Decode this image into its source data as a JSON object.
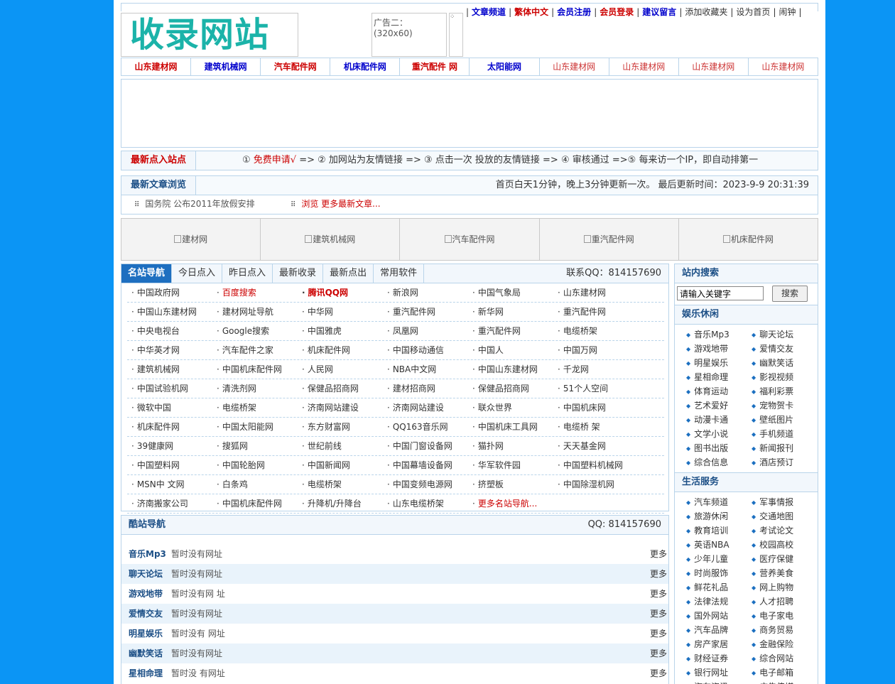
{
  "logo": {
    "text": "收录网站"
  },
  "ads": {
    "ad2": "广告二：(320x60)"
  },
  "top_links": [
    {
      "label": "文章频道",
      "color": "#0000cc"
    },
    {
      "label": "繁体中文",
      "color": "#cc0000"
    },
    {
      "label": "会员注册",
      "color": "#0000cc"
    },
    {
      "label": "会员登录",
      "color": "#cc0000"
    },
    {
      "label": "建议留言",
      "color": "#0000cc"
    },
    {
      "label": "添加收藏夹",
      "color": "#333333"
    },
    {
      "label": "设为首页",
      "color": "#333333"
    },
    {
      "label": "闹钟",
      "color": "#333333"
    }
  ],
  "nav_links": [
    {
      "label": "山东建材网",
      "color": "#cc0000"
    },
    {
      "label": "建筑机械网",
      "color": "#0000cc"
    },
    {
      "label": "汽车配件网",
      "color": "#cc0000"
    },
    {
      "label": "机床配件网",
      "color": "#0000cc"
    },
    {
      "label": "重汽配件 网",
      "color": "#cc0000"
    },
    {
      "label": "太阳能网",
      "color": "#0000cc"
    },
    {
      "label": "山东建材网",
      "color": "#cc3333"
    },
    {
      "label": "山东建材网",
      "color": "#cc3333"
    },
    {
      "label": "山东建材网",
      "color": "#cc3333"
    },
    {
      "label": "山东建材网",
      "color": "#cc3333"
    }
  ],
  "newest_join": {
    "label": "最新点入站点",
    "steps_prefix": "① ",
    "apply": "免费申请√",
    "steps_rest": " => ② 加网站为友情链接 => ③ 点击一次 投放的友情链接 => ④ 审核通过 =>⑤ 每来访一个IP，即自动排第一"
  },
  "newest_articles": {
    "label": "最新文章浏览",
    "update_info": "首页白天1分钟，晚上3分钟更新一次。 最后更新时间：2023-9-9 20:31:39",
    "items": [
      {
        "label": "国务院 公布2011年放假安排",
        "color": "#555555"
      },
      {
        "label": "浏览 更多最新文章...",
        "color": "#cc0000"
      }
    ]
  },
  "image_links": [
    "建材网",
    "建筑机械网",
    "汽车配件网",
    "重汽配件网",
    "机床配件网"
  ],
  "famous_sites": {
    "tabs": [
      "名站导航",
      "今日点入",
      "昨日点入",
      "最新收录",
      "最新点出",
      "常用软件"
    ],
    "qq": "联系QQ：814157690",
    "rows": [
      [
        {
          "t": "中国政府网"
        },
        {
          "t": "百度搜索",
          "c": "#cc0000"
        },
        {
          "t": "腾讯QQ网",
          "c": "#cc0000",
          "b": true
        },
        {
          "t": "新浪网"
        },
        {
          "t": "中国气象局"
        },
        {
          "t": "山东建材网"
        }
      ],
      [
        {
          "t": "中国山东建材网"
        },
        {
          "t": "建材网址导航"
        },
        {
          "t": "中华网"
        },
        {
          "t": "重汽配件网"
        },
        {
          "t": "新华网"
        },
        {
          "t": "重汽配件网"
        }
      ],
      [
        {
          "t": "中央电视台"
        },
        {
          "t": "Google搜索"
        },
        {
          "t": "中国雅虎"
        },
        {
          "t": "凤凰网"
        },
        {
          "t": "重汽配件网"
        },
        {
          "t": "电缆桥架"
        }
      ],
      [
        {
          "t": "中华英才网"
        },
        {
          "t": "汽车配件之家"
        },
        {
          "t": "机床配件网"
        },
        {
          "t": "中国移动通信"
        },
        {
          "t": "中国人"
        },
        {
          "t": "中国万网"
        }
      ],
      [
        {
          "t": "建筑机械网"
        },
        {
          "t": "中国机床配件网"
        },
        {
          "t": "人民网"
        },
        {
          "t": "NBA中文网"
        },
        {
          "t": "中国山东建材网"
        },
        {
          "t": "千龙网"
        }
      ],
      [
        {
          "t": "中国试验机网"
        },
        {
          "t": "清洗剂网"
        },
        {
          "t": "保健品招商网"
        },
        {
          "t": "建材招商网"
        },
        {
          "t": "保健品招商网"
        },
        {
          "t": "51个人空间"
        }
      ],
      [
        {
          "t": "微软中国"
        },
        {
          "t": "电缆桥架"
        },
        {
          "t": "济南网站建设"
        },
        {
          "t": "济南网站建设"
        },
        {
          "t": "联众世界"
        },
        {
          "t": "中国机床网"
        }
      ],
      [
        {
          "t": "机床配件网"
        },
        {
          "t": "中国太阳能网"
        },
        {
          "t": "东方财富网"
        },
        {
          "t": "QQ163音乐网"
        },
        {
          "t": "中国机床工具网"
        },
        {
          "t": "电缆桥 架"
        }
      ],
      [
        {
          "t": "39健康网"
        },
        {
          "t": "搜狐网"
        },
        {
          "t": "世纪前线"
        },
        {
          "t": "中国门窗设备网"
        },
        {
          "t": "猫扑网"
        },
        {
          "t": "天天基金网"
        }
      ],
      [
        {
          "t": "中国塑料网"
        },
        {
          "t": "中国轮胎网"
        },
        {
          "t": "中国新闻网"
        },
        {
          "t": "中国幕墙设备网"
        },
        {
          "t": "华军软件园"
        },
        {
          "t": "中国塑料机械网"
        }
      ],
      [
        {
          "t": "MSN中 文网"
        },
        {
          "t": "白条鸡"
        },
        {
          "t": "电缆桥架"
        },
        {
          "t": "中国变频电源网"
        },
        {
          "t": "挤塑板"
        },
        {
          "t": "中国除湿机网"
        }
      ],
      [
        {
          "t": "济南搬家公司"
        },
        {
          "t": "中国机床配件网"
        },
        {
          "t": "升降机/升降台"
        },
        {
          "t": "山东电缆桥架"
        },
        {
          "t": "更多名站导航...",
          "c": "#cc0000"
        },
        {
          "t": ""
        }
      ]
    ]
  },
  "cool_sites": {
    "title": "酷站导航",
    "qq": "QQ: 814157690",
    "more_label": "更多",
    "rows": [
      {
        "cat": "音乐Mp3",
        "val": "暂时没有网址"
      },
      {
        "cat": "聊天论坛",
        "val": "暂时没有网址"
      },
      {
        "cat": "游戏地带",
        "val": "暂时没有网 址"
      },
      {
        "cat": "爱情交友",
        "val": "暂时没有网址"
      },
      {
        "cat": "明星娱乐",
        "val": "暂时没有 网址"
      },
      {
        "cat": "幽默笑话",
        "val": "暂时没有网址"
      },
      {
        "cat": "星相命理",
        "val": "暂时没 有网址"
      }
    ]
  },
  "sidebar": {
    "search_title": "站内搜索",
    "search_placeholder": "请输入关键字",
    "search_button": "搜索",
    "ent_title": "娱乐休闲",
    "ent_items": [
      "音乐Mp3",
      "聊天论坛",
      "游戏地带",
      "爱情交友",
      "明星娱乐",
      "幽默笑话",
      "星相命理",
      "影视视频",
      "体育运动",
      "福利彩票",
      "艺术爱好",
      "宠物贺卡",
      "动漫卡通",
      "壁纸图片",
      "文学小说",
      "手机频道",
      "图书出版",
      "新闻报刊",
      "综合信息",
      "酒店预订"
    ],
    "life_title": "生活服务",
    "life_items": [
      "汽车频道",
      "军事情报",
      "旅游休闲",
      "交通地图",
      "教育培训",
      "考试论文",
      "英语NBA",
      "校园高校",
      "少年儿童",
      "医疗保健",
      "时尚服饰",
      "营养美食",
      "鲜花礼品",
      "网上购物",
      "法律法规",
      "人才招聘",
      "国外网站",
      "电子家电",
      "汽车品牌",
      "商务贸易",
      "房产家居",
      "金融保险",
      "财经证券",
      "综合网站",
      "银行网址",
      "电子邮箱",
      "汽车资讯",
      "广告传媒"
    ]
  }
}
